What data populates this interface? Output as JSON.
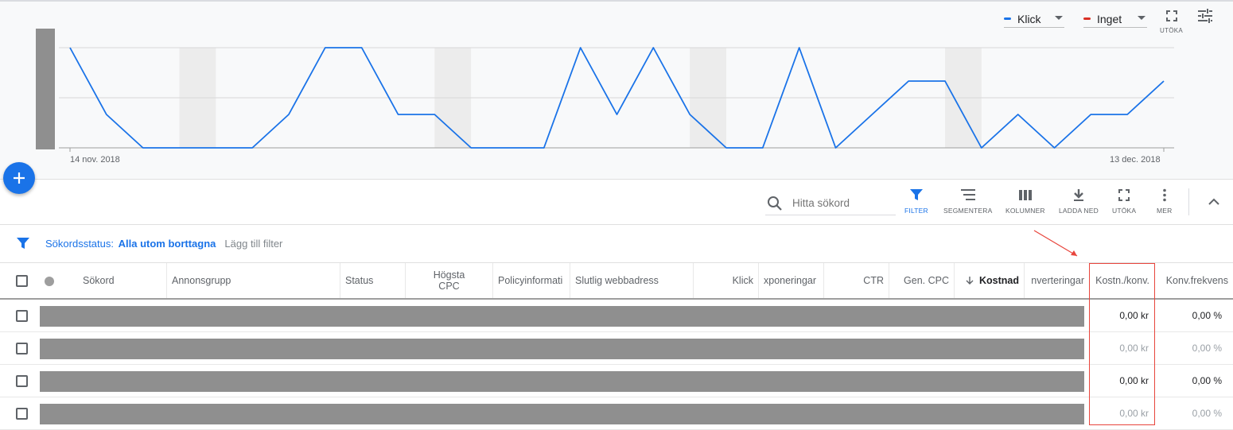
{
  "chart": {
    "legend": {
      "metric1": {
        "label": "Klick",
        "color": "#1a73e8"
      },
      "metric2": {
        "label": "Inget",
        "color": "#d93025"
      }
    },
    "expand_label": "UTÖKA",
    "start_date_label": "14 nov. 2018",
    "end_date_label": "13 dec. 2018"
  },
  "chart_data": {
    "type": "line",
    "xlabel": "",
    "ylabel": "",
    "x_start": "14 nov. 2018",
    "x_end": "13 dec. 2018",
    "series": [
      {
        "values": [
          3,
          1,
          0,
          0,
          0,
          0,
          1,
          3,
          3,
          1,
          1,
          0,
          0,
          0,
          3,
          1,
          3,
          1,
          0,
          0,
          3,
          0,
          1,
          2,
          2,
          0,
          1,
          0,
          1,
          1,
          2
        ]
      }
    ],
    "ylim": [
      0,
      4
    ],
    "weekend_bands": true,
    "grid": true
  },
  "toolbar": {
    "search_placeholder": "Hitta sökord",
    "filter": "FILTER",
    "segment": "SEGMENTERA",
    "columns": "KOLUMNER",
    "download": "LADDA NED",
    "expand": "UTÖKA",
    "more": "MER"
  },
  "filters": {
    "status_label": "Sökordsstatus:",
    "status_value": "Alla utom borttagna",
    "add_filter": "Lägg till filter"
  },
  "table": {
    "headers": {
      "keyword": "Sökord",
      "adgroup": "Annonsgrupp",
      "status": "Status",
      "max_cpc": "Högsta CPC",
      "policy": "Policyinformati",
      "final_url": "Slutlig webbadress",
      "clicks": "Klick",
      "impressions": "xponeringar",
      "ctr": "CTR",
      "avg_cpc": "Gen. CPC",
      "cost": "Kostnad",
      "conversions": "nverteringar",
      "cost_per_conv": "Kostn./konv.",
      "conv_rate": "Konv.frekvens"
    },
    "rows": [
      {
        "cost_per_conv": "0,00 kr",
        "conv_rate": "0,00 %",
        "muted": false
      },
      {
        "cost_per_conv": "0,00 kr",
        "conv_rate": "0,00 %",
        "muted": true
      },
      {
        "cost_per_conv": "0,00 kr",
        "conv_rate": "0,00 %",
        "muted": false
      },
      {
        "cost_per_conv": "0,00 kr",
        "conv_rate": "0,00 %",
        "muted": true
      }
    ]
  }
}
